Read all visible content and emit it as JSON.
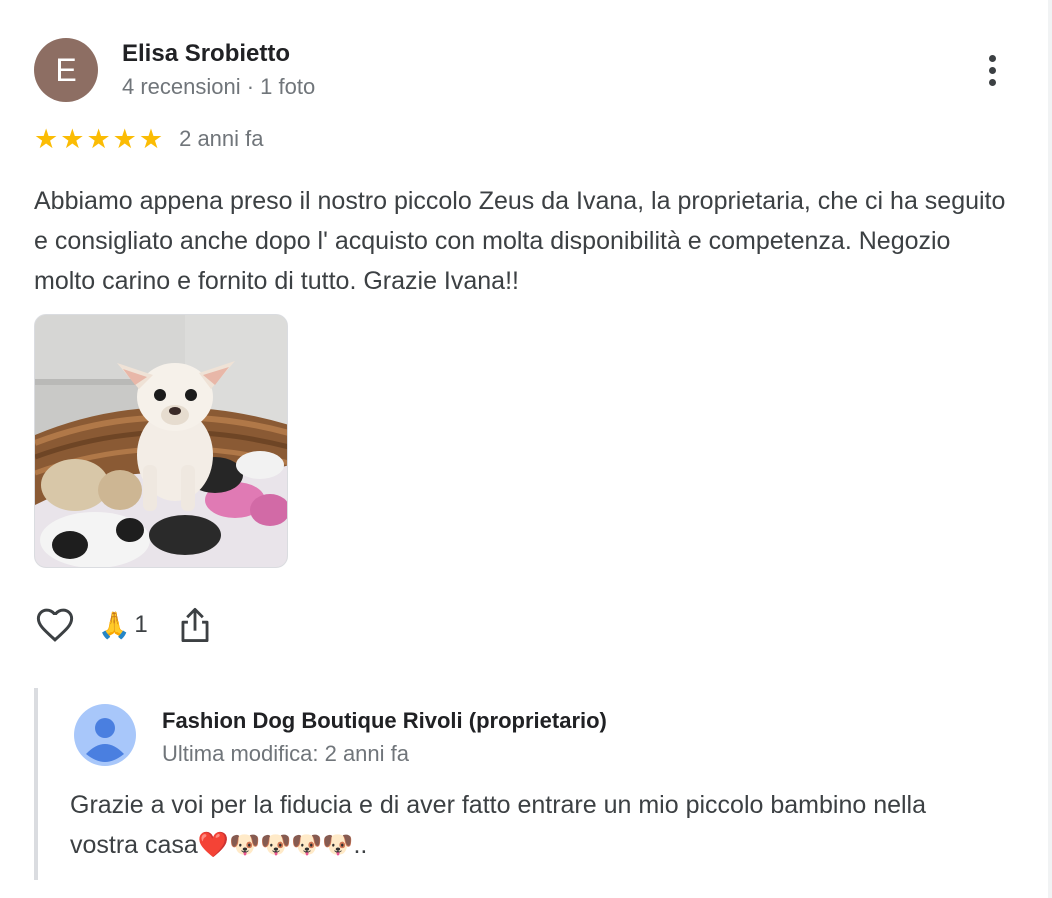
{
  "reviewer": {
    "initial": "E",
    "avatar_color": "#8d6e63",
    "name": "Elisa Srobietto",
    "meta": "4 recensioni · 1 foto"
  },
  "review": {
    "rating": 5,
    "rating_max": 5,
    "star_color": "#fbbc04",
    "time": "2 anni fa",
    "text": "Abbiamo appena preso il nostro piccolo Zeus da Ivana, la proprietaria, che ci ha seguito e consigliato anche dopo l' acquisto con molta disponibilità e competenza. Negozio molto carino e fornito di tutto. Grazie Ivana!!",
    "photo_subject": "cream chihuahua puppy in wicker basket with plush toys"
  },
  "actions": {
    "like_icon": "heart-outline-icon",
    "reaction_emoji": "🙏",
    "reaction_count": "1",
    "share_icon": "share-icon"
  },
  "owner_reply": {
    "name": "Fashion Dog Boutique Rivoli (proprietario)",
    "meta": "Ultima modifica: 2 anni fa",
    "text": "Grazie a voi per la fiducia e di aver fatto entrare un mio piccolo bambino nella vostra casa❤️🐶🐶🐶🐶.."
  }
}
